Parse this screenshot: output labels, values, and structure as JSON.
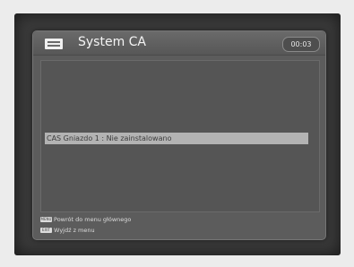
{
  "window": {
    "title": "System CA",
    "time": "00:03",
    "icon": "menu-list-icon"
  },
  "cas_list": {
    "items": [
      {
        "label": "CAS Gniazdo 1 : Nie zainstalowano",
        "selected": true
      }
    ]
  },
  "footer": {
    "hints": [
      {
        "key_icon": "menu-key-icon",
        "key_label": "MENU",
        "text": "Powrót do menu głównego"
      },
      {
        "key_icon": "exit-key-icon",
        "key_label": "EXIT",
        "text": "Wyjdź z menu"
      }
    ]
  },
  "colors": {
    "panel": "#5c5c5c",
    "selection": "#b3b3b3",
    "text": "#f4f4f4"
  }
}
